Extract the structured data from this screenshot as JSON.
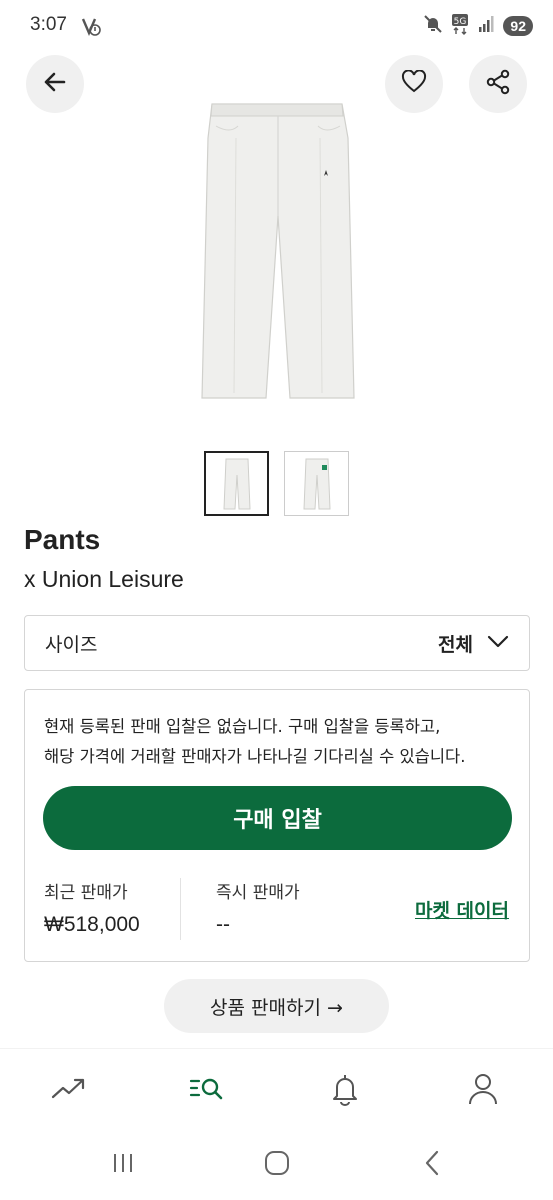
{
  "status_bar": {
    "time": "3:07",
    "battery": "92",
    "icons": [
      "notification-icon",
      "mute-icon",
      "5g-icon",
      "signal-icon"
    ]
  },
  "header": {
    "back_icon": "arrow-left-icon",
    "like_icon": "heart-icon",
    "share_icon": "share-icon"
  },
  "product": {
    "image_icon": "white-pants-image",
    "thumbnails": [
      {
        "icon": "pants-thumbnail",
        "active": true
      },
      {
        "icon": "pants-back-thumbnail",
        "active": false
      }
    ],
    "title": "Pants",
    "subtitle": "x Union Leisure"
  },
  "size_select": {
    "label": "사이즈",
    "value": "전체"
  },
  "bid": {
    "notice_line1": "현재 등록된 판매 입찰은 없습니다. 구매 입찰을 등록하고,",
    "notice_line2": "해당 가격에 거래할 판매자가 나타나길 기다리실 수 있습니다.",
    "button_label": "구매 입찰",
    "recent_label": "최근 판매가",
    "recent_value": "₩518,000",
    "instant_label": "즉시 판매가",
    "instant_value": "--",
    "market_link": "마켓 데이터",
    "accent_color": "#0c6b3d"
  },
  "sell_button": {
    "label": "상품 판매하기 →"
  },
  "bottom_nav": {
    "items": [
      {
        "icon": "trending-icon",
        "active": false
      },
      {
        "icon": "search-list-icon",
        "active": true
      },
      {
        "icon": "bell-icon",
        "active": false
      },
      {
        "icon": "user-icon",
        "active": false
      }
    ]
  },
  "system_nav": {
    "items": [
      "recent-apps-icon",
      "home-icon",
      "back-icon"
    ]
  }
}
